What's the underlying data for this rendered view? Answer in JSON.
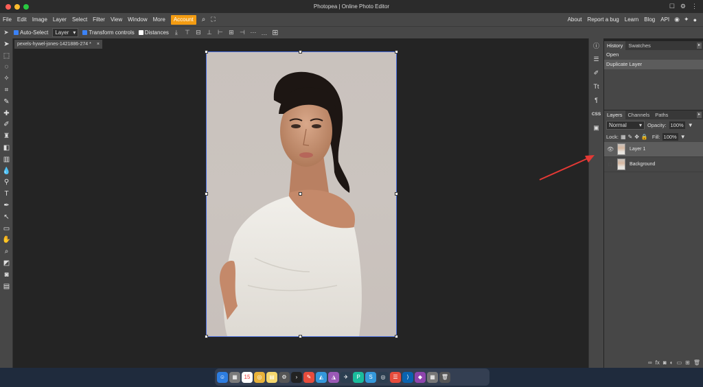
{
  "window": {
    "title": "Photopea | Online Photo Editor"
  },
  "menu": {
    "items": [
      "File",
      "Edit",
      "Image",
      "Layer",
      "Select",
      "Filter",
      "View",
      "Window",
      "More"
    ],
    "account": "Account",
    "right_items": [
      "About",
      "Report a bug",
      "Learn",
      "Blog",
      "API"
    ]
  },
  "options": {
    "auto_select": "Auto-Select",
    "layer_select": "Layer",
    "transform_controls": "Transform controls",
    "distances": "Distances"
  },
  "document": {
    "tab_name": "pexels-hywel-jones-1421886-274",
    "tab_modified": "*",
    "close": "×"
  },
  "history": {
    "tabs": [
      "History",
      "Swatches"
    ],
    "items": [
      "Open",
      "Duplicate Layer"
    ]
  },
  "layers": {
    "tabs": [
      "Layers",
      "Channels",
      "Paths"
    ],
    "blend_mode": "Normal",
    "opacity_label": "Opacity:",
    "opacity_value": "100%",
    "lock_label": "Lock:",
    "fill_label": "Fill:",
    "fill_value": "100%",
    "list": [
      {
        "name": "Layer 1",
        "visible": true,
        "selected": true
      },
      {
        "name": "Background",
        "visible": false,
        "selected": false
      }
    ]
  },
  "side_panel": {
    "css_label": "CSS"
  },
  "dock": {
    "calendar_day": "15"
  },
  "colors": {
    "accent": "#f39c12",
    "checkbox_on": "#3b82f6",
    "selection": "#4a6fe0",
    "annotation_arrow": "#e53935"
  }
}
